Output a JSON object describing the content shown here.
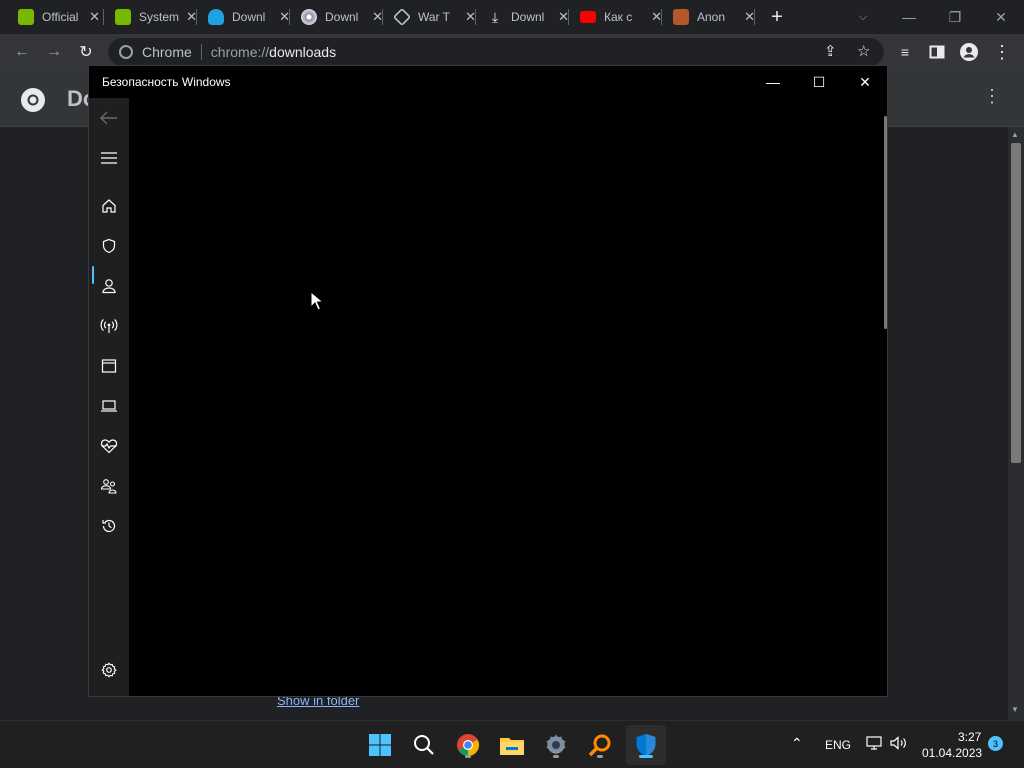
{
  "browser": {
    "tabs": [
      {
        "title": "Official",
        "favicon": "nvidia-icon",
        "color": "#76b900"
      },
      {
        "title": "System",
        "favicon": "nvidia-icon",
        "color": "#76b900"
      },
      {
        "title": "Downl",
        "favicon": "download-cloud-icon",
        "color": "#1fa3e0"
      },
      {
        "title": "Downl",
        "favicon": "disc-icon",
        "color": "#8e8ea0"
      },
      {
        "title": "War T",
        "favicon": "tank-icon",
        "color": "#bdc1c6"
      },
      {
        "title": "Downl",
        "favicon": "download-icon",
        "color": "#e8eaed",
        "active": true
      },
      {
        "title": "Как с",
        "favicon": "youtube-icon",
        "color": "#ff0000"
      },
      {
        "title": "Anon",
        "favicon": "avatar-icon",
        "color": "#b5562b"
      }
    ],
    "new_tab": "+",
    "omnibox": {
      "site": "Chrome",
      "scheme": "chrome://",
      "host": "downloads"
    },
    "downloads_title_partial": "Do",
    "show_in_folder": "Show in folder"
  },
  "security_window": {
    "title": "Безопасность Windows",
    "nav_items": [
      {
        "name": "home",
        "icon": "home-icon"
      },
      {
        "name": "virus-protection",
        "icon": "shield-icon",
        "selected": true
      },
      {
        "name": "account-protection",
        "icon": "person-icon"
      },
      {
        "name": "firewall",
        "icon": "antenna-icon"
      },
      {
        "name": "app-browser-control",
        "icon": "window-icon"
      },
      {
        "name": "device-security",
        "icon": "laptop-icon"
      },
      {
        "name": "device-performance",
        "icon": "heart-pulse-icon"
      },
      {
        "name": "family-options",
        "icon": "family-icon"
      },
      {
        "name": "protection-history",
        "icon": "history-icon"
      },
      {
        "name": "settings",
        "icon": "gear-icon"
      }
    ],
    "accent": "#4cc2ff"
  },
  "taskbar": {
    "apps": [
      "windows-start-icon",
      "search-icon",
      "chrome-icon",
      "file-explorer-icon",
      "settings-icon",
      "search-tool-icon",
      "windows-security-icon"
    ],
    "language": "ENG",
    "time": "3:27",
    "date": "01.04.2023",
    "notifications": "3"
  }
}
